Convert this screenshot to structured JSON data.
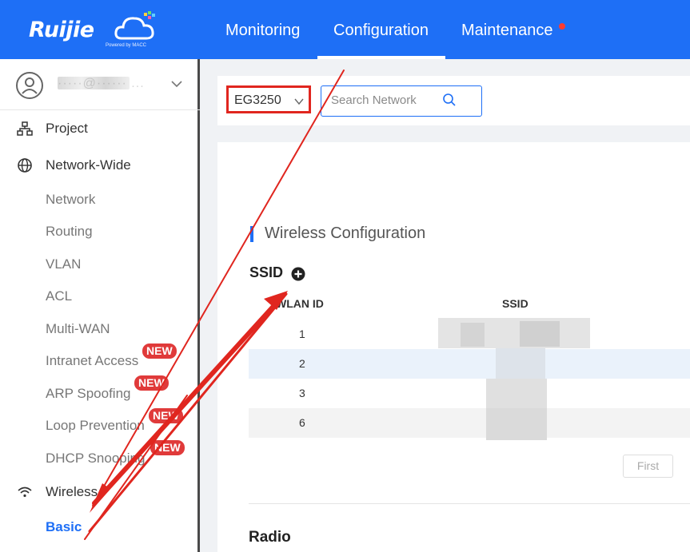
{
  "app": {
    "logo_text": "Ruijie",
    "logo_sub": "Powered by MACC",
    "brand_color": "#1e6ff6"
  },
  "nav": {
    "monitoring": "Monitoring",
    "configuration": "Configuration",
    "maintenance": "Maintenance",
    "active": "Configuration"
  },
  "user": {
    "name_masked": "·····@······ ..."
  },
  "sidebar": {
    "project": "Project",
    "network_wide": "Network-Wide",
    "sub_items": [
      {
        "label": "Network"
      },
      {
        "label": "Routing"
      },
      {
        "label": "VLAN"
      },
      {
        "label": "ACL"
      },
      {
        "label": "Multi-WAN"
      },
      {
        "label": "Intranet Access",
        "badge": "NEW"
      },
      {
        "label": "ARP Spoofing",
        "badge": "NEW"
      },
      {
        "label": "Loop Prevention",
        "badge": "NEW"
      },
      {
        "label": "DHCP Snooping",
        "badge": "NEW"
      }
    ],
    "wireless": "Wireless",
    "basic": "Basic"
  },
  "filter": {
    "device": "EG3250",
    "search_placeholder": "Search Network"
  },
  "main": {
    "section_title": "Wireless Configuration",
    "ssid_title": "SSID",
    "columns": [
      "WLAN ID",
      "SSID"
    ],
    "rows": [
      {
        "wlan_id": "1"
      },
      {
        "wlan_id": "2"
      },
      {
        "wlan_id": "3"
      },
      {
        "wlan_id": "6"
      }
    ],
    "pager_first": "First",
    "radio_title": "Radio"
  },
  "annotation": {
    "highlight_color": "#e0261f"
  }
}
